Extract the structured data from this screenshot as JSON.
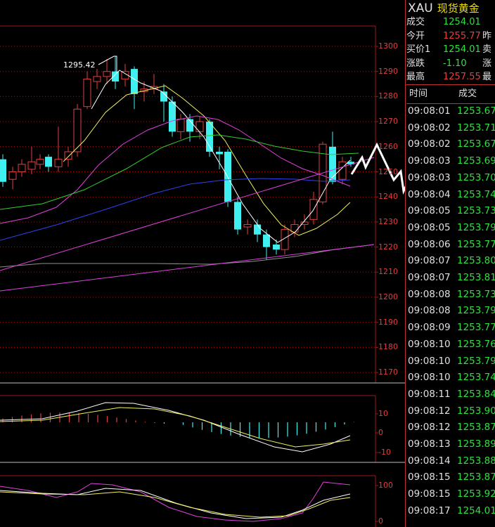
{
  "chart": {
    "price_axis": [
      "1300",
      "1290",
      "1280",
      "1270",
      "1260",
      "1250",
      "1240",
      "1230",
      "1220",
      "1210",
      "1200",
      "1190",
      "1180",
      "1170"
    ],
    "high_marker": "1295.42",
    "macd_axis": [
      "10",
      "0",
      "-10"
    ],
    "kdj_axis": [
      "100",
      "0"
    ]
  },
  "quote": {
    "symbol": "XAU",
    "name": "现货黄金",
    "rows": [
      {
        "label": "成交",
        "value": "1254.01",
        "color": "#30e040",
        "label2": ""
      },
      {
        "label": "今开",
        "value": "1255.77",
        "color": "#e04040",
        "label2": "昨"
      },
      {
        "label": "买价1",
        "value": "1254.01",
        "color": "#30e040",
        "label2": "卖"
      },
      {
        "label": "涨跌",
        "value": "-1.10",
        "color": "#30e040",
        "label2": "涨"
      },
      {
        "label": "最高",
        "value": "1257.55",
        "color": "#e04040",
        "label2": "最"
      }
    ]
  },
  "ticks": {
    "header_time": "时间",
    "header_price": "成交",
    "rows": [
      {
        "time": "09:08:01",
        "price": "1253.67"
      },
      {
        "time": "09:08:02",
        "price": "1253.71"
      },
      {
        "time": "09:08:02",
        "price": "1253.67"
      },
      {
        "time": "09:08:03",
        "price": "1253.69"
      },
      {
        "time": "09:08:03",
        "price": "1253.70"
      },
      {
        "time": "09:08:04",
        "price": "1253.74"
      },
      {
        "time": "09:08:05",
        "price": "1253.73"
      },
      {
        "time": "09:08:05",
        "price": "1253.79"
      },
      {
        "time": "09:08:06",
        "price": "1253.77"
      },
      {
        "time": "09:08:07",
        "price": "1253.80"
      },
      {
        "time": "09:08:07",
        "price": "1253.81"
      },
      {
        "time": "09:08:08",
        "price": "1253.73"
      },
      {
        "time": "09:08:08",
        "price": "1253.79"
      },
      {
        "time": "09:08:09",
        "price": "1253.77"
      },
      {
        "time": "09:08:10",
        "price": "1253.76"
      },
      {
        "time": "09:08:10",
        "price": "1253.79"
      },
      {
        "time": "09:08:10",
        "price": "1253.74"
      },
      {
        "time": "09:08:11",
        "price": "1253.84"
      },
      {
        "time": "09:08:12",
        "price": "1253.90"
      },
      {
        "time": "09:08:12",
        "price": "1253.87"
      },
      {
        "time": "09:08:13",
        "price": "1253.89"
      },
      {
        "time": "09:08:14",
        "price": "1253.88"
      },
      {
        "time": "09:08:15",
        "price": "1253.87"
      },
      {
        "time": "09:08:15",
        "price": "1253.92"
      },
      {
        "time": "09:08:17",
        "price": "1254.01"
      }
    ]
  },
  "colors": {
    "up": "#e04040",
    "down": "#40f0f0",
    "grid": "#a01818",
    "text_green": "#30e040"
  }
}
